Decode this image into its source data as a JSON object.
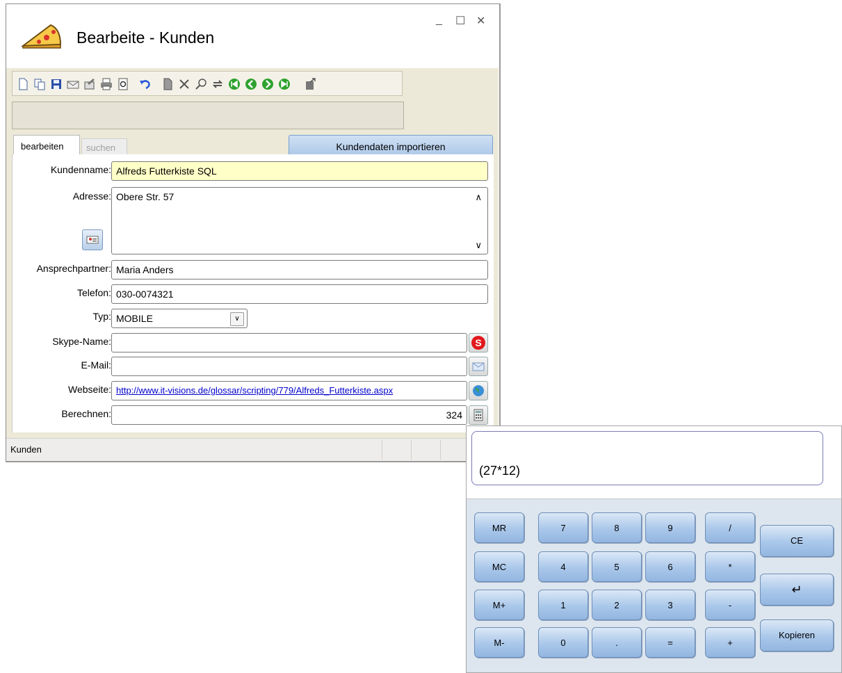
{
  "window": {
    "title": "Bearbeite - Kunden",
    "controls": {
      "minimize": "_",
      "maximize": "☐",
      "close": "✕"
    }
  },
  "tabs": [
    {
      "label": "bearbeiten",
      "active": true
    },
    {
      "label": "suchen",
      "active": false
    }
  ],
  "import_button": "Kundendaten importieren",
  "form": {
    "kundenname": {
      "label": "Kundenname:",
      "value": "Alfreds Futterkiste SQL"
    },
    "adresse": {
      "label": "Adresse:",
      "value": "Obere Str. 57"
    },
    "ansprechpartner": {
      "label": "Ansprechpartner:",
      "value": "Maria Anders"
    },
    "telefon": {
      "label": "Telefon:",
      "value": "030-0074321"
    },
    "typ": {
      "label": "Typ:",
      "value": "MOBILE"
    },
    "skype": {
      "label": "Skype-Name:",
      "value": ""
    },
    "email": {
      "label": "E-Mail:",
      "value": ""
    },
    "webseite": {
      "label": "Webseite:",
      "value": "http://www.it-visions.de/glossar/scripting/779/Alfreds_Futterkiste.aspx"
    },
    "berechnen": {
      "label": "Berechnen:",
      "value": "324"
    }
  },
  "statusbar": {
    "text": "Kunden"
  },
  "calculator": {
    "expression": "(27*12)",
    "keys": {
      "mr": "MR",
      "mc": "MC",
      "mplus": "M+",
      "mminus": "M-",
      "k7": "7",
      "k8": "8",
      "k9": "9",
      "div": "/",
      "k4": "4",
      "k5": "5",
      "k6": "6",
      "mul": "*",
      "k1": "1",
      "k2": "2",
      "k3": "3",
      "minus": "-",
      "k0": "0",
      "dot": ".",
      "eq": "=",
      "plus": "+",
      "ce": "CE",
      "enter": "↵",
      "copy": "Kopieren"
    }
  },
  "colors": {
    "highlight_field": "#ffffc8",
    "link": "#0000cc",
    "panel": "#ece9d8"
  },
  "icons": [
    "new-icon",
    "copy-icon",
    "save-icon",
    "envelope-icon",
    "edit-icon",
    "print-icon",
    "preview-icon",
    "undo-icon",
    "document-icon",
    "delete-icon",
    "search-icon",
    "refresh-icon",
    "first-icon",
    "prev-icon",
    "next-icon",
    "last-icon",
    "export-icon"
  ]
}
